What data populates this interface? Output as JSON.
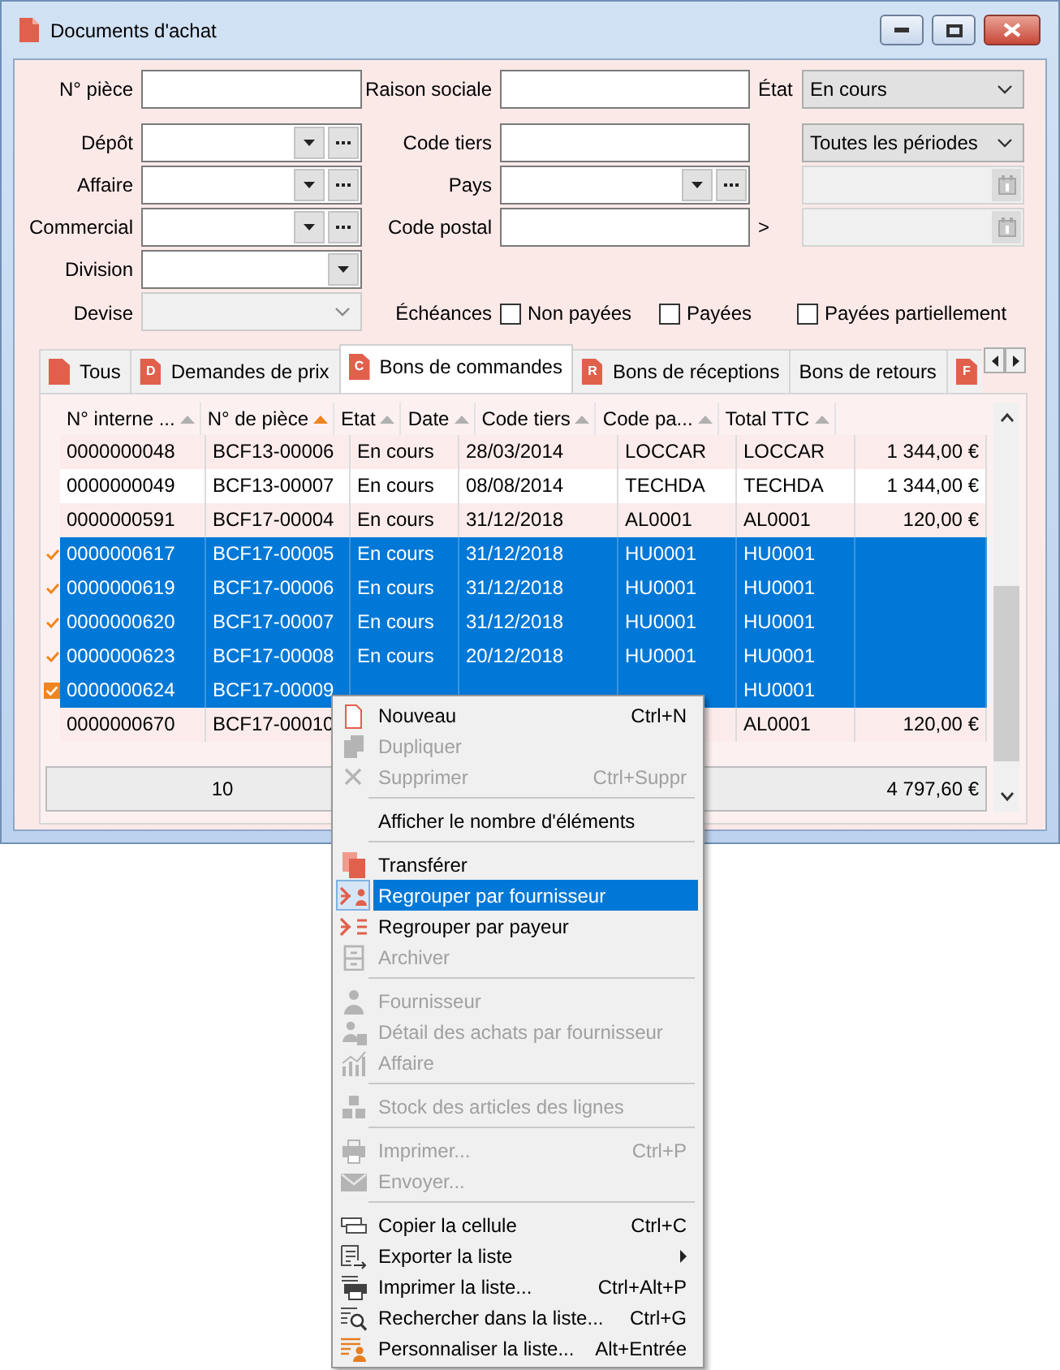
{
  "window": {
    "title": "Documents d'achat"
  },
  "filter_rows": [
    [
      {
        "label": "N° pièce",
        "kind": "text"
      },
      {
        "label": "Raison sociale",
        "kind": "text"
      },
      {
        "label": "État",
        "kind": "select",
        "value": "En cours",
        "disabled": false
      }
    ],
    [
      {
        "label": "Dépôt",
        "kind": "combo"
      },
      {
        "label": "Code tiers",
        "kind": "text"
      },
      {
        "kind": "select",
        "value": "Toutes les périodes",
        "disabled": false
      }
    ],
    [
      {
        "label": "Affaire",
        "kind": "combo"
      },
      {
        "label": "Pays",
        "kind": "combo"
      },
      {
        "kind": "date"
      }
    ],
    [
      {
        "label": "Commercial",
        "kind": "combo"
      },
      {
        "label": "Code postal",
        "kind": "text"
      },
      {
        "label": ">",
        "kind": "date"
      }
    ],
    [
      {
        "label": "Division",
        "kind": "dropdown"
      }
    ],
    [
      {
        "label": "Devise",
        "kind": "select",
        "disabled": true
      },
      {
        "label": "Échéances",
        "kind": "checks",
        "options": [
          {
            "label": "Non payées",
            "checked": false
          },
          {
            "label": "Payées",
            "checked": false
          },
          {
            "label": "Payées partiellement",
            "checked": false
          }
        ]
      }
    ]
  ],
  "tabs": [
    {
      "kind": "document",
      "label": "Tous",
      "selected": false
    },
    {
      "kind": "document",
      "label": "Demandes de prix",
      "icon_letter": "D",
      "selected": false
    },
    {
      "kind": "document",
      "label": "Bons de commandes",
      "icon_letter": "C",
      "selected": true
    },
    {
      "kind": "document",
      "label": "Bons de réceptions",
      "icon_letter": "R",
      "selected": false
    },
    {
      "kind": "plain",
      "label": "Bons de retours",
      "selected": false
    },
    {
      "kind": "document",
      "icon_letter": "F",
      "selected": false
    }
  ],
  "table": {
    "columns": [
      {
        "label": "N° interne ...",
        "kind": "text",
        "sorted": false
      },
      {
        "label": "N° de pièce",
        "kind": "text",
        "sorted": true
      },
      {
        "label": "Etat",
        "kind": "text",
        "sorted": false
      },
      {
        "label": "Date",
        "kind": "text",
        "sorted": false
      },
      {
        "label": "Code tiers",
        "kind": "text",
        "sorted": false
      },
      {
        "label": "Code pa...",
        "kind": "text",
        "sorted": false
      },
      {
        "label": "Total TTC",
        "kind": "amount",
        "sorted": false
      }
    ],
    "rows": [
      {
        "cells": {
          "internal_no": "0000000048",
          "document_no": "BCF13-00006",
          "status": "En cours",
          "date": "28/03/2014",
          "third_party_code": "LOCCAR",
          "column_6": "LOCCAR",
          "total": "1 344,00 €"
        },
        "selected": false,
        "checked": false,
        "focused": false
      },
      {
        "cells": {
          "internal_no": "0000000049",
          "document_no": "BCF13-00007",
          "status": "En cours",
          "date": "08/08/2014",
          "third_party_code": "TECHDA",
          "column_6": "TECHDA",
          "total": "1 344,00 €"
        },
        "selected": false,
        "checked": false,
        "focused": false
      },
      {
        "cells": {
          "internal_no": "0000000591",
          "document_no": "BCF17-00004",
          "status": "En cours",
          "date": "31/12/2018",
          "third_party_code": "AL0001",
          "column_6": "AL0001",
          "total": "120,00 €"
        },
        "selected": false,
        "checked": false,
        "focused": false
      },
      {
        "cells": {
          "internal_no": "0000000617",
          "document_no": "BCF17-00005",
          "status": "En cours",
          "date": "31/12/2018",
          "third_party_code": "HU0001",
          "column_6": "HU0001"
        },
        "selected": true,
        "checked": true,
        "focused": false
      },
      {
        "cells": {
          "internal_no": "0000000619",
          "document_no": "BCF17-00006",
          "status": "En cours",
          "date": "31/12/2018",
          "third_party_code": "HU0001",
          "column_6": "HU0001"
        },
        "selected": true,
        "checked": true,
        "focused": false
      },
      {
        "cells": {
          "internal_no": "0000000620",
          "document_no": "BCF17-00007",
          "status": "En cours",
          "date": "31/12/2018",
          "third_party_code": "HU0001",
          "column_6": "HU0001"
        },
        "selected": true,
        "checked": true,
        "focused": false
      },
      {
        "cells": {
          "internal_no": "0000000623",
          "document_no": "BCF17-00008",
          "status": "En cours",
          "date": "20/12/2018",
          "third_party_code": "HU0001",
          "column_6": "HU0001"
        },
        "selected": true,
        "checked": true,
        "focused": false
      },
      {
        "cells": {
          "internal_no": "0000000624",
          "document_no": "BCF17-00009",
          "column_6": "HU0001"
        },
        "selected": true,
        "checked": true,
        "focused": true
      },
      {
        "cells": {
          "internal_no": "0000000670",
          "document_no": "BCF17-00010",
          "column_6": "AL0001",
          "total": "120,00 €"
        },
        "selected": false,
        "checked": false,
        "focused": false
      }
    ],
    "footer": {
      "count": "10",
      "total": "4 797,60 €"
    }
  },
  "context_menu": [
    {
      "kind": "item",
      "label": "Nouveau",
      "shortcut": "Ctrl+N",
      "disabled": false,
      "selected": false,
      "submenu": false
    },
    {
      "kind": "item",
      "label": "Dupliquer",
      "disabled": true,
      "selected": false,
      "submenu": false
    },
    {
      "kind": "item",
      "label": "Supprimer",
      "shortcut": "Ctrl+Suppr",
      "disabled": true,
      "selected": false,
      "submenu": false
    },
    {
      "kind": "separator"
    },
    {
      "kind": "item",
      "label": "Afficher le nombre d'éléments",
      "disabled": false,
      "selected": false,
      "submenu": false
    },
    {
      "kind": "separator"
    },
    {
      "kind": "item",
      "label": "Transférer",
      "disabled": false,
      "selected": false,
      "submenu": false
    },
    {
      "kind": "item",
      "label": "Regrouper par fournisseur",
      "disabled": false,
      "selected": true,
      "submenu": false
    },
    {
      "kind": "item",
      "label": "Regrouper par payeur",
      "disabled": false,
      "selected": false,
      "submenu": false
    },
    {
      "kind": "item",
      "label": "Archiver",
      "disabled": true,
      "selected": false,
      "submenu": false
    },
    {
      "kind": "separator"
    },
    {
      "kind": "item",
      "label": "Fournisseur",
      "disabled": true,
      "selected": false,
      "submenu": false
    },
    {
      "kind": "item",
      "label": "Détail des achats par fournisseur",
      "disabled": true,
      "selected": false,
      "submenu": false
    },
    {
      "kind": "item",
      "label": "Affaire",
      "disabled": true,
      "selected": false,
      "submenu": false
    },
    {
      "kind": "separator"
    },
    {
      "kind": "item",
      "label": "Stock des articles des lignes",
      "disabled": true,
      "selected": false,
      "submenu": false
    },
    {
      "kind": "separator"
    },
    {
      "kind": "item",
      "label": "Imprimer...",
      "shortcut": "Ctrl+P",
      "disabled": true,
      "selected": false,
      "submenu": false
    },
    {
      "kind": "item",
      "label": "Envoyer...",
      "disabled": true,
      "selected": false,
      "submenu": false
    },
    {
      "kind": "separator"
    },
    {
      "kind": "item",
      "label": "Copier la cellule",
      "shortcut": "Ctrl+C",
      "disabled": false,
      "selected": false,
      "submenu": false
    },
    {
      "kind": "item",
      "label": "Exporter la liste",
      "disabled": false,
      "selected": false,
      "submenu": true
    },
    {
      "kind": "item",
      "label": "Imprimer la liste...",
      "shortcut": "Ctrl+Alt+P",
      "disabled": false,
      "selected": false,
      "submenu": false
    },
    {
      "kind": "item",
      "label": "Rechercher dans la liste...",
      "shortcut": "Ctrl+G",
      "disabled": false,
      "selected": false,
      "submenu": false
    },
    {
      "kind": "item",
      "label": "Personnaliser la liste...",
      "shortcut": "Alt+Entrée",
      "disabled": false,
      "selected": false,
      "submenu": false
    }
  ]
}
